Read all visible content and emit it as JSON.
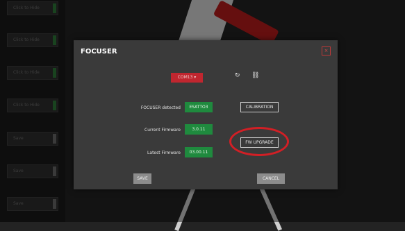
{
  "background": {
    "rail_buttons": [
      {
        "label": "Click to Hide",
        "state": "green"
      },
      {
        "label": "Click to Hide",
        "state": "green"
      },
      {
        "label": "Click to Hide",
        "state": "green"
      },
      {
        "label": "Click to Hide",
        "state": "green"
      },
      {
        "label": "Save",
        "state": "gray"
      },
      {
        "label": "Save",
        "state": "gray"
      },
      {
        "label": "Save",
        "state": "gray"
      }
    ]
  },
  "dialog": {
    "title": "FOCUSER",
    "close_label": "×",
    "port_select": "COM13 ▾",
    "refresh_icon": "↻",
    "disconnect_icon": "⛓",
    "detected_label": "FOCUSER detected",
    "detected_value": "ESATTO3",
    "current_fw_label": "Current Firmware",
    "current_fw_value": "3.0.11",
    "latest_fw_label": "Latest Firmware",
    "latest_fw_value": "03.00.11",
    "calibration_label": "CALIBRATION",
    "fw_upgrade_label": "FW UPGRADE",
    "save_label": "SAVE",
    "cancel_label": "CANCEL"
  },
  "colors": {
    "accent_red": "#c0262f",
    "value_green": "#1f8a3e",
    "dialog_bg": "#3a3a3a"
  }
}
